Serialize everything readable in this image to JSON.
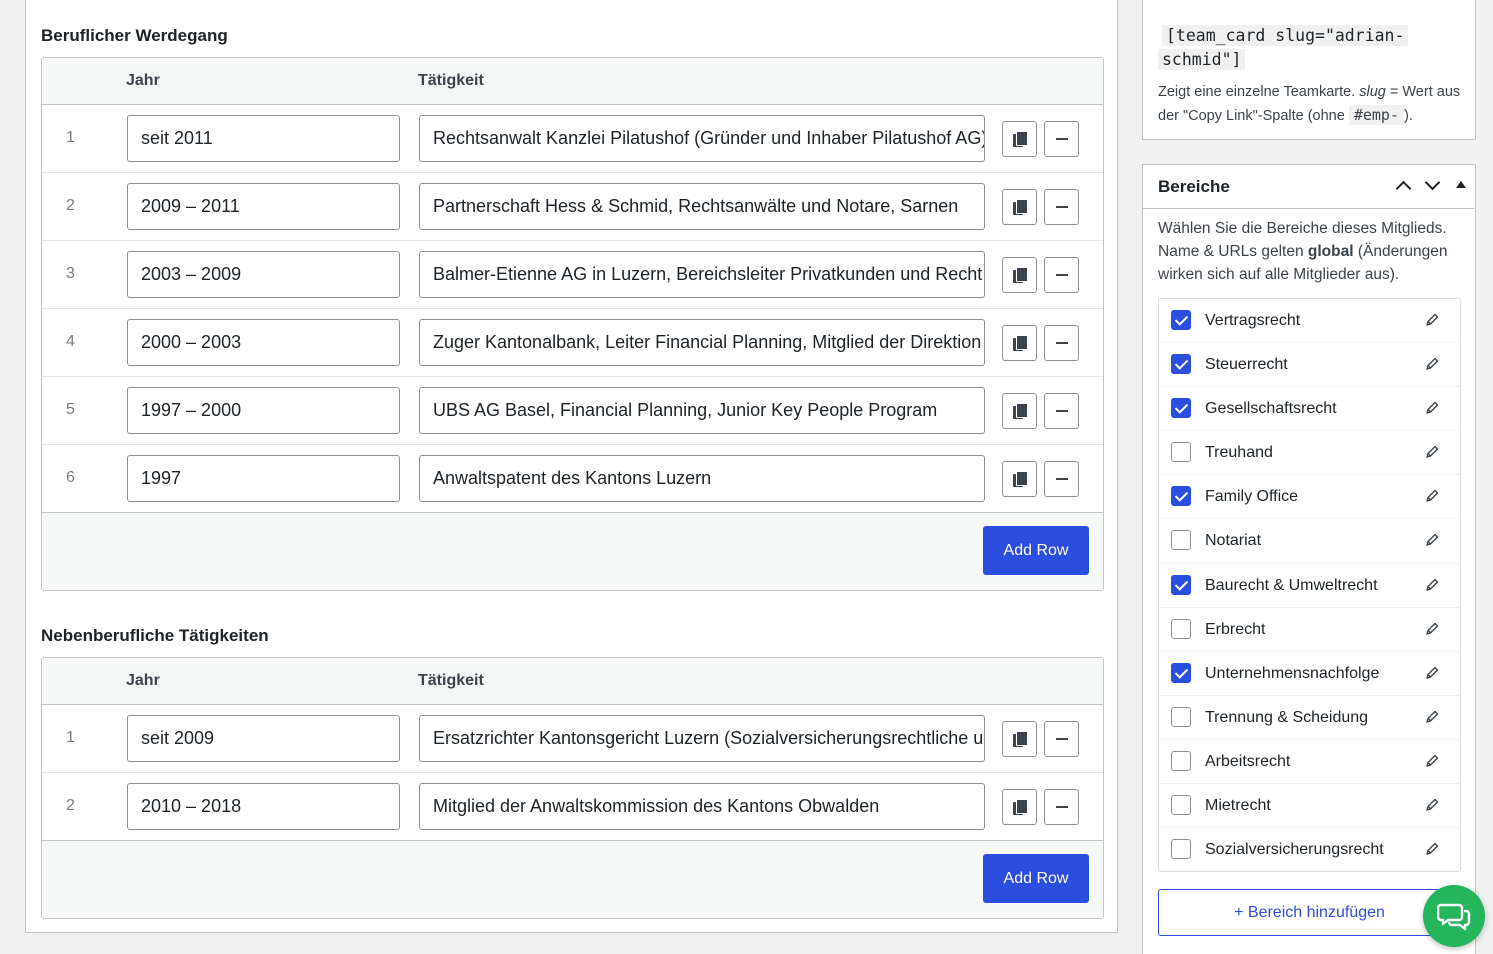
{
  "career": {
    "title": "Beruflicher Werdegang",
    "col_year": "Jahr",
    "col_activity": "Tätigkeit",
    "rows": [
      {
        "num": "1",
        "year": "seit 2011",
        "activity": "Rechtsanwalt Kanzlei Pilatushof (Gründer und Inhaber Pilatushof AG)"
      },
      {
        "num": "2",
        "year": "2009 – 2011",
        "activity": "Partnerschaft Hess & Schmid, Rechtsanwälte und Notare, Sarnen"
      },
      {
        "num": "3",
        "year": "2003 – 2009",
        "activity": "Balmer-Etienne AG in Luzern, Bereichsleiter Privatkunden und Recht"
      },
      {
        "num": "4",
        "year": "2000 – 2003",
        "activity": "Zuger Kantonalbank, Leiter Financial Planning, Mitglied der Direktion"
      },
      {
        "num": "5",
        "year": "1997 – 2000",
        "activity": "UBS AG Basel, Financial Planning, Junior Key People Program"
      },
      {
        "num": "6",
        "year": "1997",
        "activity": "Anwaltspatent des Kantons Luzern"
      }
    ],
    "add_label": "Add Row"
  },
  "side_jobs": {
    "title": "Nebenberufliche Tätigkeiten",
    "col_year": "Jahr",
    "col_activity": "Tätigkeit",
    "rows": [
      {
        "num": "1",
        "year": "seit 2009",
        "activity": "Ersatzrichter Kantonsgericht Luzern (Sozialversicherungsrechtliche ur"
      },
      {
        "num": "2",
        "year": "2010 – 2018",
        "activity": "Mitglied der Anwaltskommission des Kantons Obwalden"
      }
    ],
    "add_label": "Add Row"
  },
  "shortcode": {
    "code_line1": "[team_card slug=\"adrian-",
    "code_line2": "schmid\"]",
    "desc_pre": "Zeigt eine einzelne Teamkarte. ",
    "desc_slug": "slug",
    "desc_mid": " = Wert aus der \"Copy Link\"-Spalte (ohne ",
    "desc_code": "#emp-",
    "desc_post": ")."
  },
  "bereiche": {
    "title": "Bereiche",
    "desc_pre": "Wählen Sie die Bereiche dieses Mitglieds. Name & URLs gelten ",
    "desc_bold": "global",
    "desc_post": " (Änderungen wirken sich auf alle Mitglieder aus).",
    "items": [
      {
        "label": "Vertragsrecht",
        "checked": true
      },
      {
        "label": "Steuerrecht",
        "checked": true
      },
      {
        "label": "Gesellschaftsrecht",
        "checked": true
      },
      {
        "label": "Treuhand",
        "checked": false
      },
      {
        "label": "Family Office",
        "checked": true
      },
      {
        "label": "Notariat",
        "checked": false
      },
      {
        "label": "Baurecht & Umweltrecht",
        "checked": true
      },
      {
        "label": "Erbrecht",
        "checked": false
      },
      {
        "label": "Unternehmensnachfolge",
        "checked": true
      },
      {
        "label": "Trennung & Scheidung",
        "checked": false
      },
      {
        "label": "Arbeitsrecht",
        "checked": false
      },
      {
        "label": "Mietrecht",
        "checked": false
      },
      {
        "label": "Sozialversicherungsrecht",
        "checked": false
      }
    ],
    "add_label": "+ Bereich hinzufügen"
  },
  "colors": {
    "accent": "#2b4de0",
    "chat": "#25b55c"
  }
}
